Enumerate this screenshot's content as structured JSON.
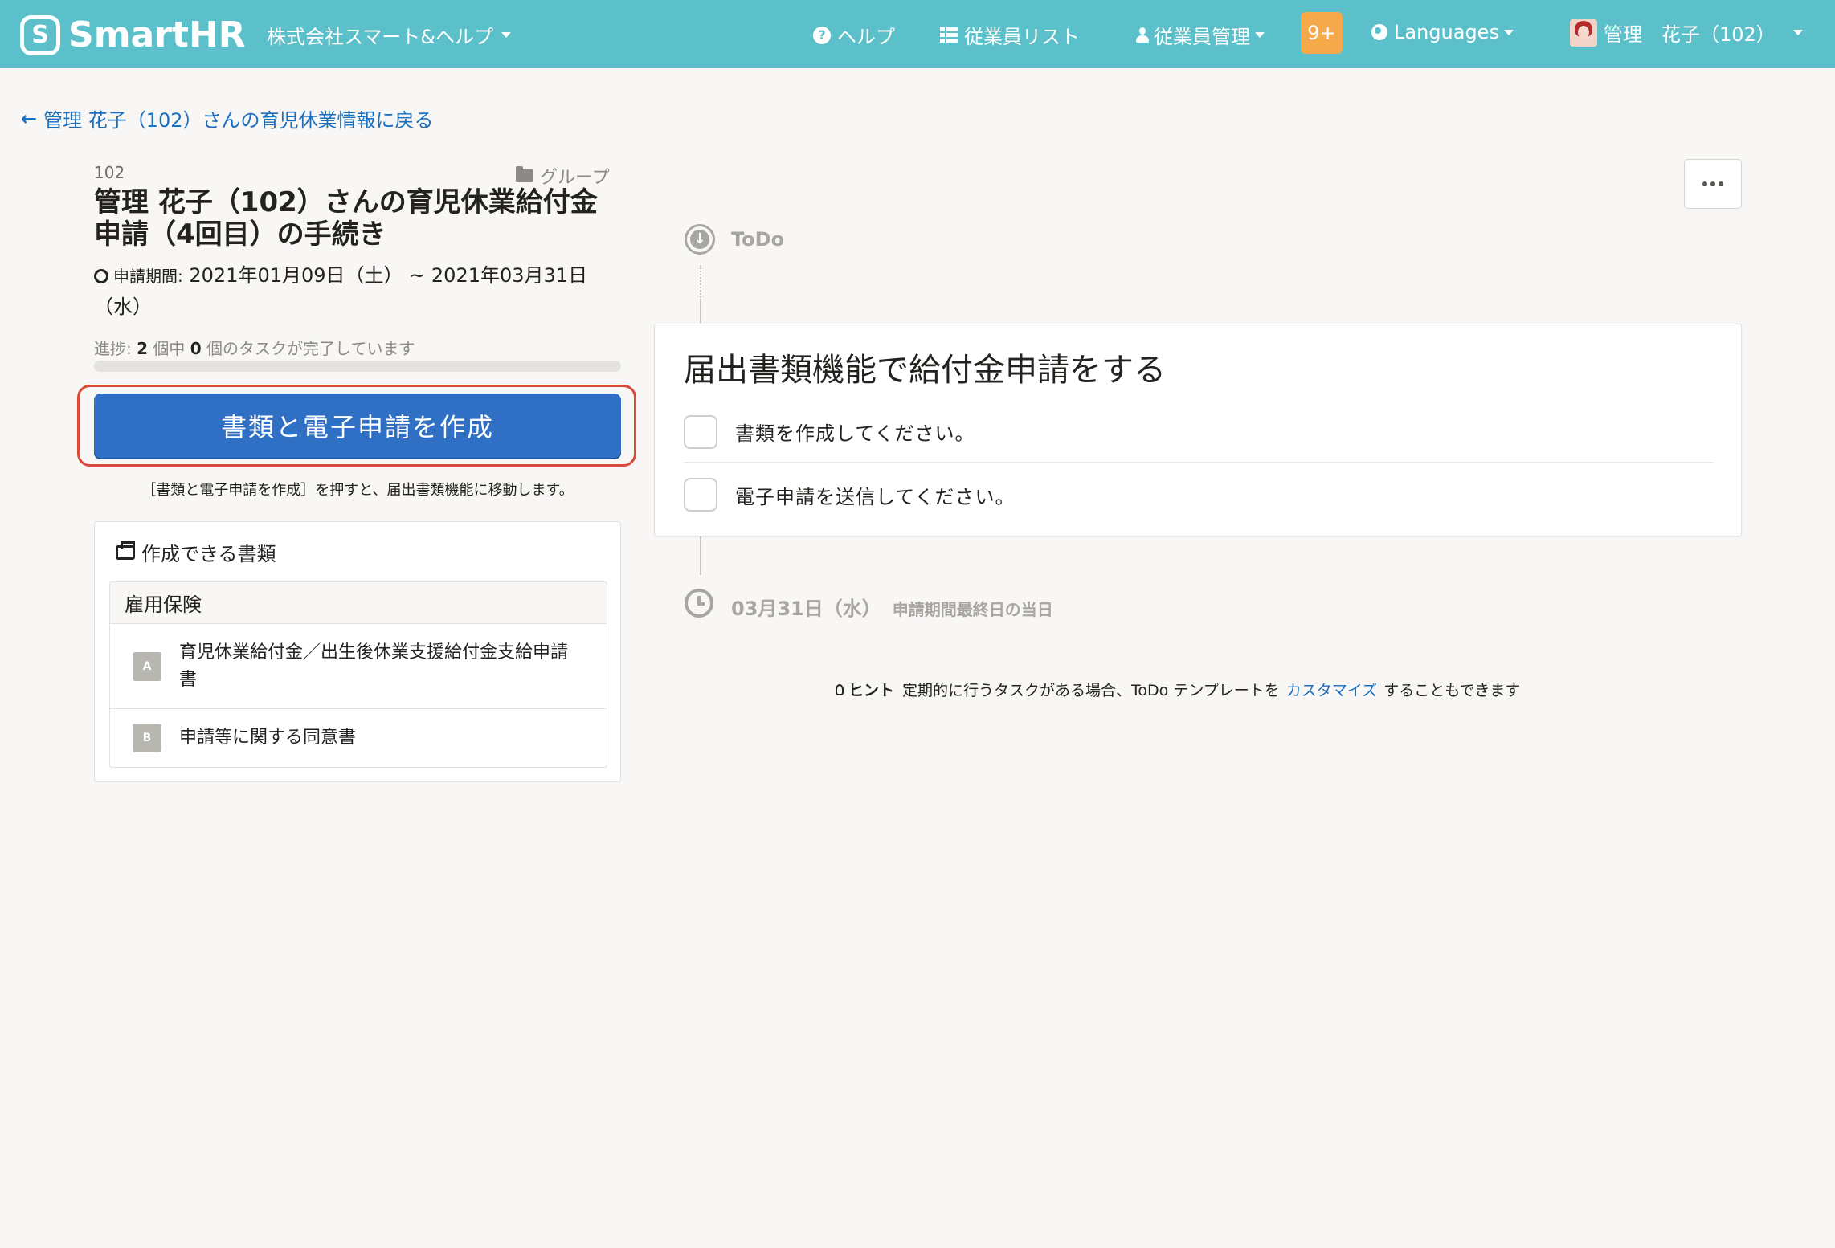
{
  "header": {
    "logo_mark": "S",
    "logo_text": "SmartHR",
    "company": "株式会社スマート&ヘルプ",
    "nav": {
      "help": "ヘルプ",
      "employee_list": "従業員リスト",
      "employee_manage": "従業員管理",
      "notifications": "9+",
      "languages": "Languages",
      "user": "管理　花子（102）"
    }
  },
  "back_link": "管理 花子（102）さんの育児休業情報に戻る",
  "procedure": {
    "employee_id": "102",
    "group": "グループ",
    "title": "管理 花子（102）さんの育児休業給付金申請（4回目）の手続き",
    "period_label": "申請期間:",
    "period_value": "2021年01月09日（土） ~ 2021年03月31日（水）",
    "progress": {
      "prefix": "進捗: ",
      "total": "2",
      "mid": " 個中 ",
      "done": "0",
      "suffix": " 個のタスクが完了しています",
      "fraction": 0
    },
    "create_button": "書類と電子申請を作成",
    "create_note": "［書類と電子申請を作成］を押すと、届出書類機能に移動します。"
  },
  "documents": {
    "title": "作成できる書類",
    "group": "雇用保険",
    "items": [
      {
        "letter": "A",
        "name": "育児休業給付金／出生後休業支援給付金支給申請書"
      },
      {
        "letter": "B",
        "name": "申請等に関する同意書"
      }
    ]
  },
  "timeline": {
    "todo_label": "ToDo",
    "task_title": "届出書類機能で給付金申請をする",
    "tasks": [
      "書類を作成してください。",
      "電子申請を送信してください。"
    ],
    "deadline_date": "03月31日（水）",
    "deadline_sub": "申請期間最終日の当日"
  },
  "hint": {
    "label": "ヒント",
    "text_before": "定期的に行うタスクがある場合、ToDo テンプレートを",
    "link": "カスタマイズ",
    "text_after": "することもできます"
  },
  "colors": {
    "header_bg": "#5bc0c9",
    "primary": "#2f6fc4",
    "link": "#1a6fbf",
    "badge": "#f5a94a",
    "highlight": "#d94a3a"
  }
}
